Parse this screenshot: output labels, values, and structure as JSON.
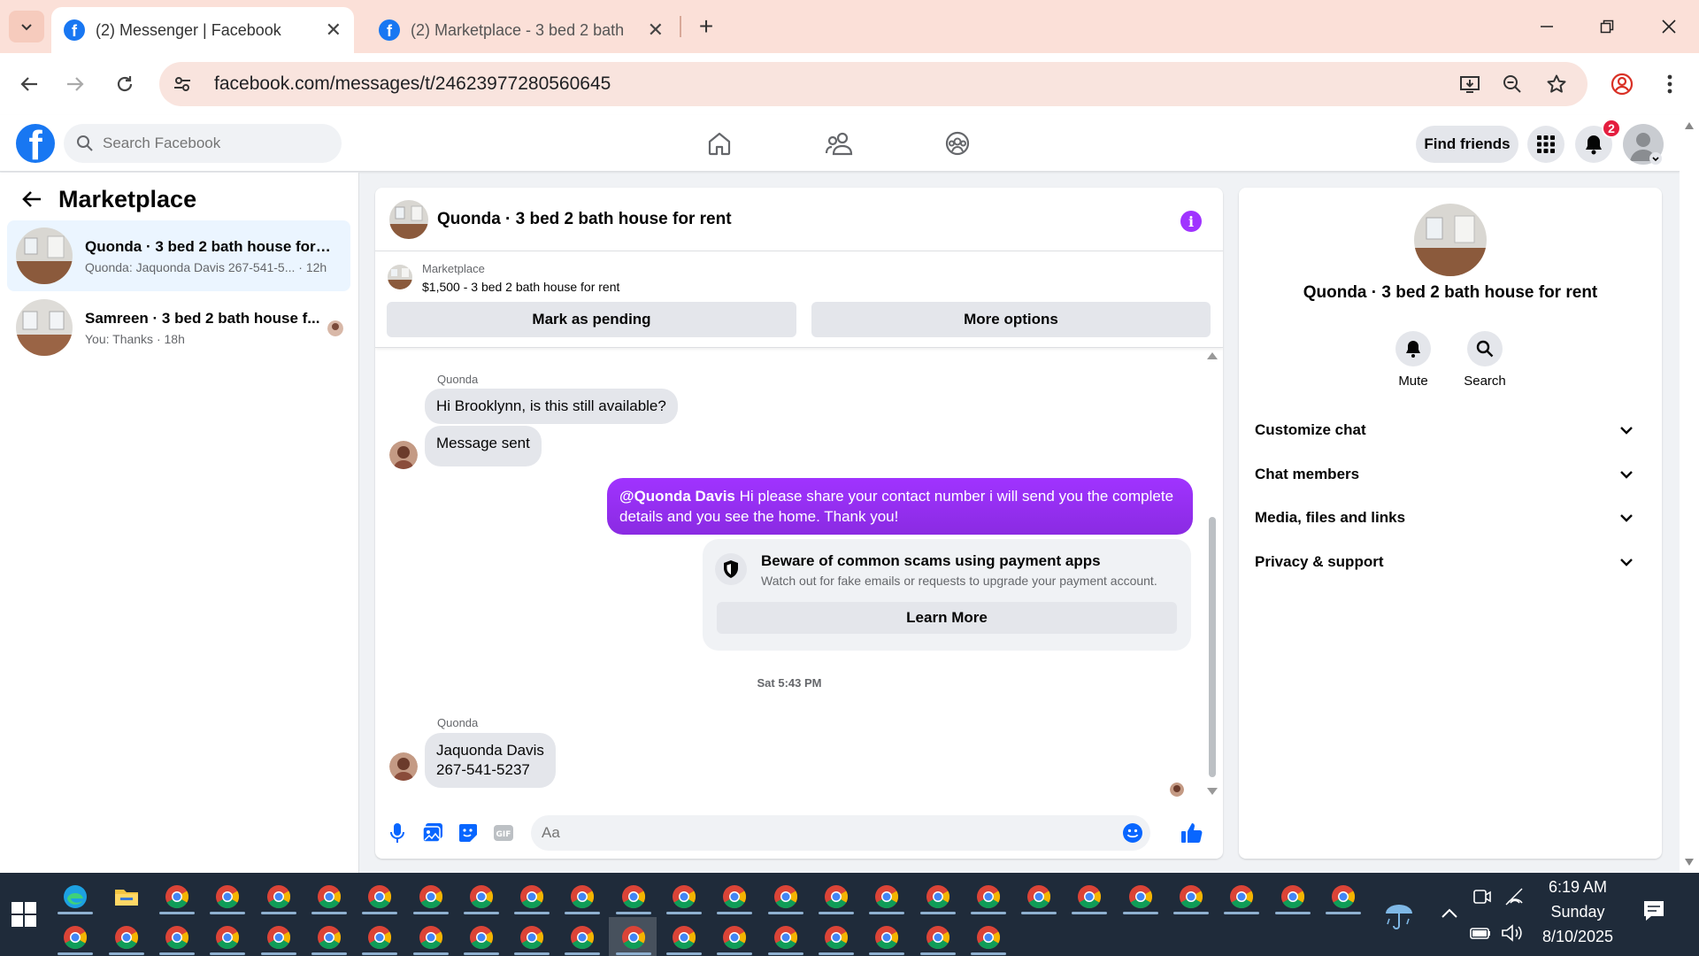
{
  "browser": {
    "tabs": [
      {
        "title": "(2) Messenger | Facebook",
        "active": true
      },
      {
        "title": "(2) Marketplace - 3 bed 2 bath",
        "active": false
      }
    ],
    "url": "facebook.com/messages/t/24623977280560645"
  },
  "fb_header": {
    "logo": "f",
    "search_placeholder": "Search Facebook",
    "find_friends": "Find friends",
    "notification_count": "2"
  },
  "sidebar": {
    "title": "Marketplace",
    "conversations": [
      {
        "name": "Quonda · 3 bed 2 bath house for r...",
        "preview": "Quonda: Jaquonda Davis 267-541-5... · 12h",
        "active": true
      },
      {
        "name": "Samreen · 3 bed 2 bath house f...",
        "preview": "You: Thanks · 18h",
        "active": false
      }
    ]
  },
  "chat": {
    "title": "Quonda · 3 bed 2 bath house for rent",
    "listing": {
      "source": "Marketplace",
      "title": "$1,500 - 3 bed 2 bath house for rent",
      "mark_pending": "Mark as pending",
      "more_options": "More options"
    },
    "messages": {
      "sender_1": "Quonda",
      "in_1": "Hi Brooklynn, is this still available?",
      "in_2": "Message sent",
      "out_mention": "@Quonda Davis",
      "out_text_line1": " Hi please share your contact number i will send you the complete",
      "out_text_line2": "details and you see the home. Thank you!",
      "scam_title": "Beware of common scams using payment apps",
      "scam_sub": "Watch out for fake emails or requests to upgrade your payment account.",
      "learn_more": "Learn More",
      "timestamp": "Sat 5:43 PM",
      "sender_2": "Quonda",
      "in_3_line1": "Jaquonda Davis",
      "in_3_line2": "267-541-5237"
    },
    "composer_placeholder": "Aa"
  },
  "right_panel": {
    "name": "Quonda · 3 bed 2 bath house for rent",
    "actions": [
      {
        "label": "Mute",
        "icon": "bell-icon"
      },
      {
        "label": "Search",
        "icon": "search-icon"
      }
    ],
    "sections": [
      "Customize chat",
      "Chat members",
      "Media, files and links",
      "Privacy & support"
    ]
  },
  "taskbar": {
    "time": "6:19 AM",
    "day": "Sunday",
    "date": "8/10/2025"
  },
  "colors": {
    "fb_blue": "#1877f2",
    "messenger_purple": "#a033ff",
    "tabbar": "#fbe0d8"
  }
}
